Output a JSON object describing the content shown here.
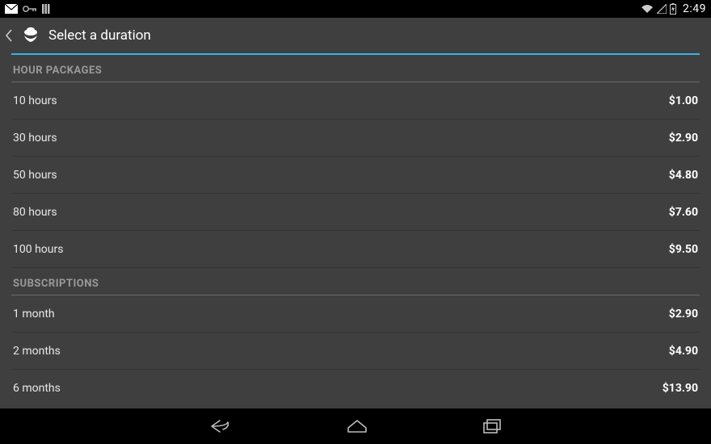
{
  "status_bar": {
    "clock": "2:49"
  },
  "action_bar": {
    "title": "Select a duration"
  },
  "accent_color": "#33b5e5",
  "sections": [
    {
      "header": "HOUR PACKAGES",
      "items": [
        {
          "label": "10 hours",
          "price": "$1.00"
        },
        {
          "label": "30 hours",
          "price": "$2.90"
        },
        {
          "label": "50 hours",
          "price": "$4.80"
        },
        {
          "label": "80 hours",
          "price": "$7.60"
        },
        {
          "label": "100 hours",
          "price": "$9.50"
        }
      ]
    },
    {
      "header": "SUBSCRIPTIONS",
      "items": [
        {
          "label": "1 month",
          "price": "$2.90"
        },
        {
          "label": "2 months",
          "price": "$4.90"
        },
        {
          "label": "6 months",
          "price": "$13.90"
        }
      ]
    }
  ]
}
